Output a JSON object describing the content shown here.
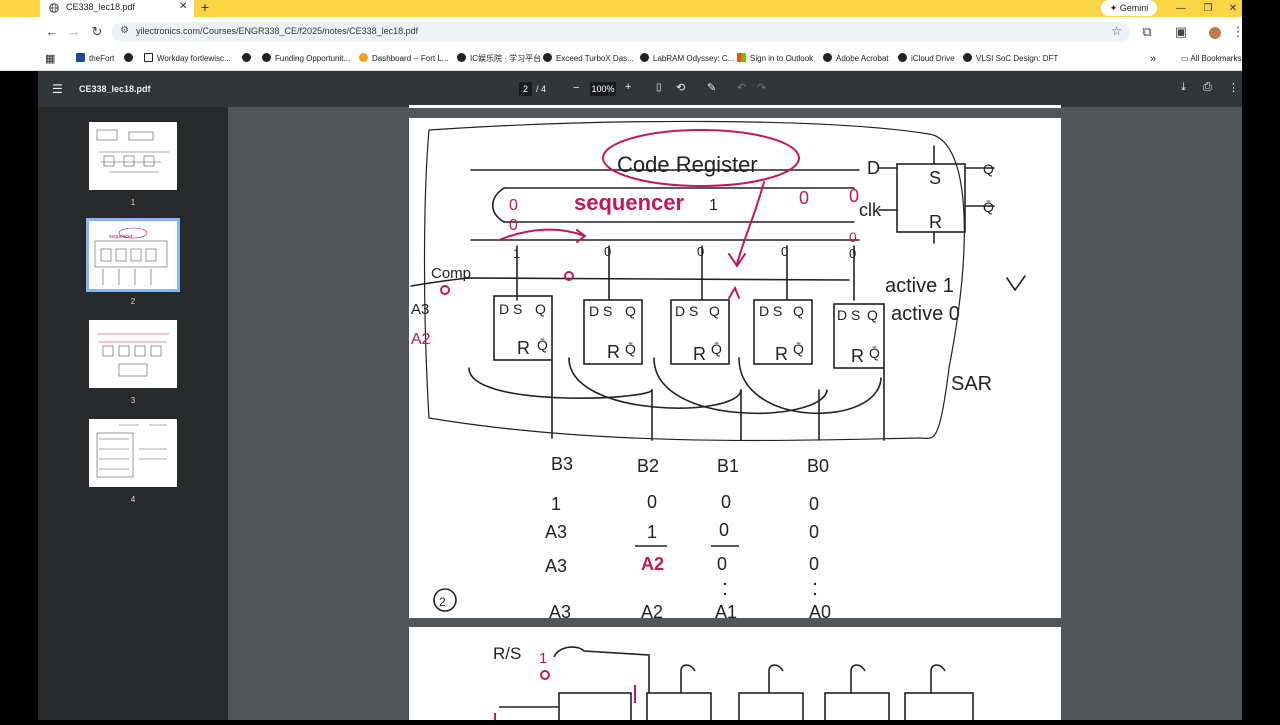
{
  "browser": {
    "tab_title": "CE338_lec18.pdf",
    "new_tab": "+",
    "gemini_label": "Gemini",
    "url": "yilectronics.com/Courses/ENGR338_CE/f2025/notes/CE338_lec18.pdf",
    "bookmarks": [
      "theFort",
      "Workday fortlewisc...",
      "Funding Opportunit...",
      "Dashboard -- Fort L...",
      "IC娱乐院 · 学习平台",
      "Exceed TurboX Das...",
      "LabRAM Odyssey: C...",
      "Sign in to Outlook",
      "Adobe Acrobat",
      "iCloud Drive",
      "VLSI SoC Design: DFT"
    ],
    "all_bookmarks": "All Bookmarks"
  },
  "pdf": {
    "filename": "CE338_lec18.pdf",
    "current_page": "2",
    "total_pages": "/ 4",
    "zoom": "100%",
    "thumbnails": [
      "1",
      "2",
      "3",
      "4"
    ],
    "selected_page": 2
  },
  "notes": {
    "title": "Code Register",
    "sequencer": "sequencer",
    "comp": "Comp",
    "a1": "A3",
    "a2": "A2",
    "ff_d": "D",
    "ff_s": "S",
    "ff_q": "Q",
    "ff_r": "R",
    "ff_qbar": "Q̄",
    "ff_clk": "clk",
    "active1": "active 1",
    "active0": "active 0",
    "sar": "SAR",
    "page_mark": "2",
    "bit_headers": [
      "B3",
      "B2",
      "B1",
      "B0"
    ],
    "table_rows": [
      [
        "1",
        "0",
        "0",
        "0"
      ],
      [
        "A3",
        "1",
        "0",
        "0"
      ],
      [
        "A3",
        "A2",
        "0",
        "0"
      ],
      [
        "A3",
        "A2",
        "A1",
        "A0"
      ]
    ],
    "seq_bits": [
      "0",
      "0",
      "1",
      "0",
      "0",
      "0"
    ],
    "seq_bits2": [
      "1",
      "0",
      "0",
      "0",
      "0"
    ],
    "rs_label": "R/S",
    "rs_val": "1"
  }
}
